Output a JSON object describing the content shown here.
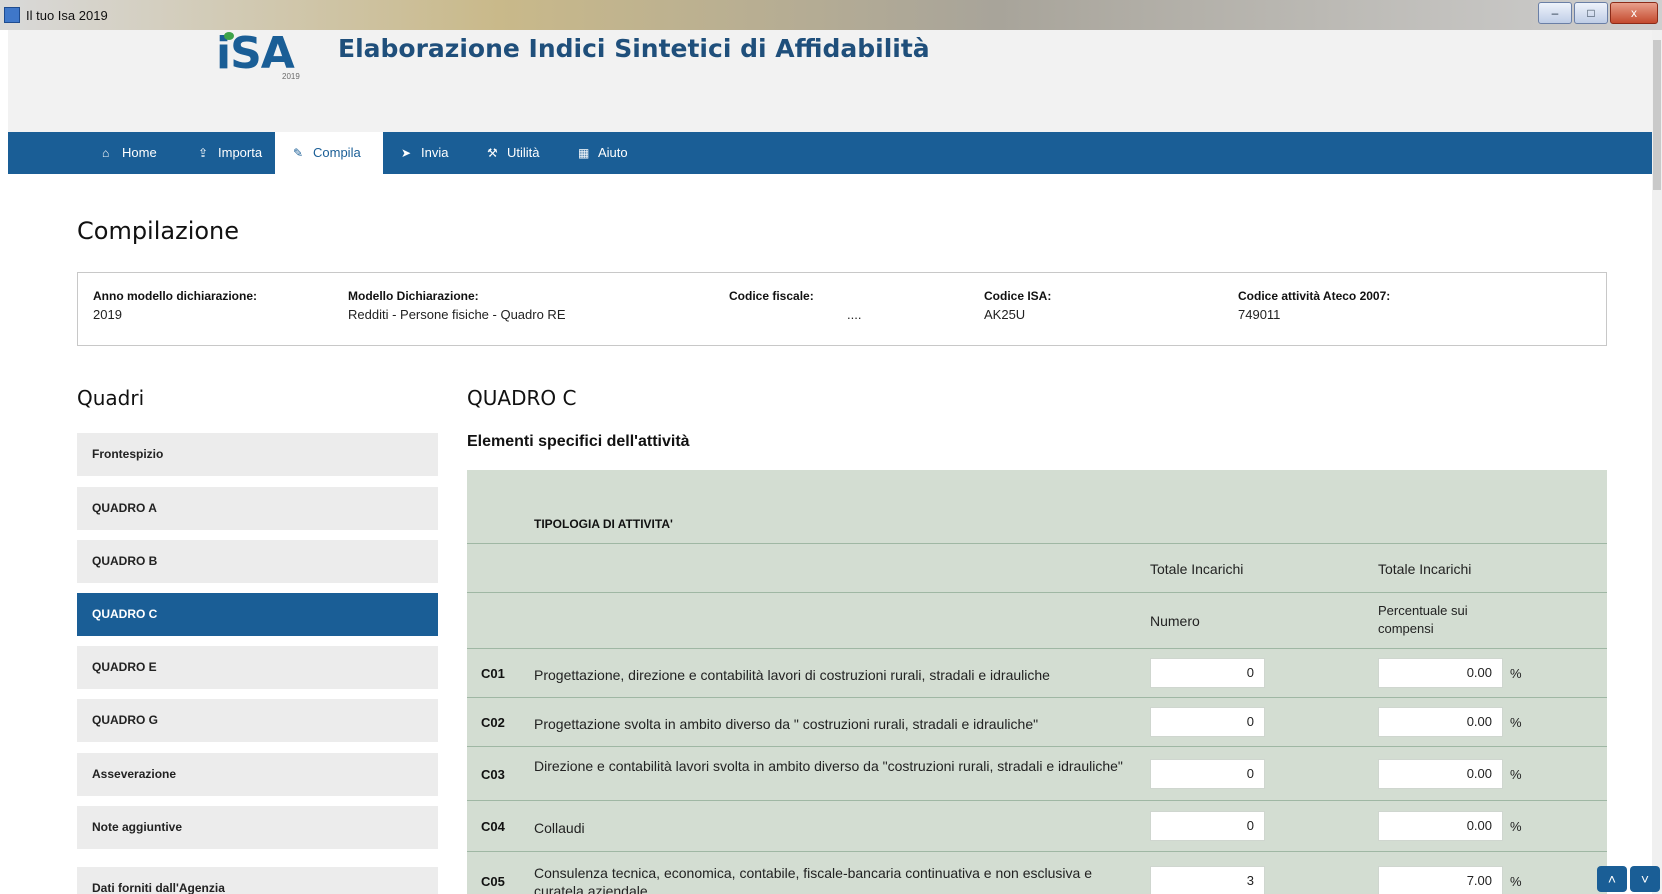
{
  "window": {
    "title": "Il tuo Isa 2019",
    "minimize_glyph": "–",
    "maximize_glyph": "□",
    "close_glyph": "x"
  },
  "header": {
    "logo_text": "iSA",
    "logo_year": "2019",
    "app_title": "Elaborazione Indici Sintetici di Affidabilità"
  },
  "nav": {
    "items": [
      {
        "label": "Home",
        "icon": "home-icon"
      },
      {
        "label": "Importa",
        "icon": "upload-icon"
      },
      {
        "label": "Compila",
        "icon": "pencil-icon"
      },
      {
        "label": "Invia",
        "icon": "send-icon"
      },
      {
        "label": "Utilità",
        "icon": "wrench-icon"
      },
      {
        "label": "Aiuto",
        "icon": "book-icon"
      }
    ],
    "active": "Compila"
  },
  "page": {
    "title": "Compilazione"
  },
  "info": {
    "anno_label": "Anno modello dichiarazione:",
    "anno_value": "2019",
    "modello_label": "Modello Dichiarazione:",
    "modello_value": "Redditi - Persone fisiche - Quadro RE",
    "cf_label": "Codice fiscale:",
    "cf_value": "....",
    "isa_label": "Codice ISA:",
    "isa_value": "AK25U",
    "ateco_label": "Codice attività Ateco 2007:",
    "ateco_value": "749011"
  },
  "sidebar": {
    "title": "Quadri",
    "items": [
      {
        "label": "Frontespizio"
      },
      {
        "label": "QUADRO A"
      },
      {
        "label": "QUADRO B"
      },
      {
        "label": "QUADRO C"
      },
      {
        "label": "QUADRO E"
      },
      {
        "label": "QUADRO G"
      },
      {
        "label": "Asseverazione"
      },
      {
        "label": "Note aggiuntive"
      },
      {
        "label": "Dati forniti dall'Agenzia"
      }
    ],
    "active": "QUADRO C"
  },
  "quadro": {
    "title": "QUADRO C",
    "subtitle": "Elementi specifici dell'attività",
    "tipologia_header": "TIPOLOGIA DI ATTIVITA'",
    "col1_header": "Totale Incarichi",
    "col2_header": "Totale Incarichi",
    "col1_sub": "Numero",
    "col2_sub": "Percentuale sui compensi",
    "pct_symbol": "%",
    "rows": [
      {
        "code": "C01",
        "description": "Progettazione, direzione e contabilità lavori di costruzioni rurali, stradali e idrauliche",
        "numero": "0",
        "percentuale": "0.00"
      },
      {
        "code": "C02",
        "description": "Progettazione svolta in ambito diverso da \" costruzioni rurali, stradali e idrauliche\"",
        "numero": "0",
        "percentuale": "0.00"
      },
      {
        "code": "C03",
        "description": "Direzione e contabilità lavori svolta in ambito diverso da \"costruzioni rurali, stradali e idrauliche\"",
        "numero": "0",
        "percentuale": "0.00"
      },
      {
        "code": "C04",
        "description": "Collaudi",
        "numero": "0",
        "percentuale": "0.00"
      },
      {
        "code": "C05",
        "description": "Consulenza tecnica, economica, contabile, fiscale-bancaria continuativa e non esclusiva e curatela aziendale",
        "numero": "3",
        "percentuale": "7.00"
      }
    ]
  },
  "scroll_buttons": {
    "up_glyph": "˄",
    "down_glyph": "˅"
  }
}
